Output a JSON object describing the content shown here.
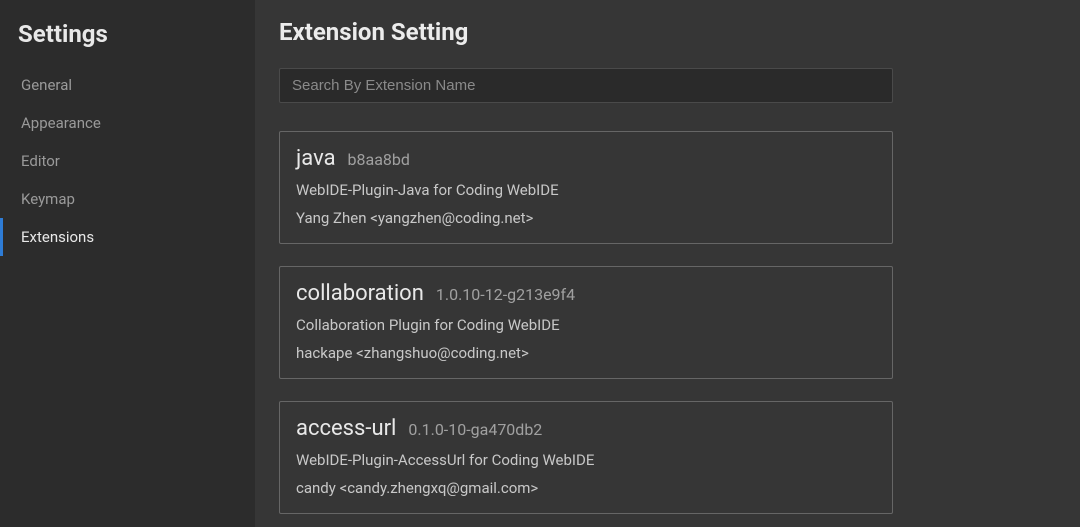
{
  "sidebar": {
    "title": "Settings",
    "items": [
      {
        "label": "General"
      },
      {
        "label": "Appearance"
      },
      {
        "label": "Editor"
      },
      {
        "label": "Keymap"
      },
      {
        "label": "Extensions"
      }
    ],
    "activeIndex": 4
  },
  "main": {
    "title": "Extension Setting",
    "search": {
      "placeholder": "Search By Extension Name",
      "value": ""
    },
    "extensions": [
      {
        "name": "java",
        "version": "b8aa8bd",
        "description": "WebIDE-Plugin-Java for Coding WebIDE",
        "author": "Yang Zhen <yangzhen@coding.net>"
      },
      {
        "name": "collaboration",
        "version": "1.0.10-12-g213e9f4",
        "description": "Collaboration Plugin for Coding WebIDE",
        "author": "hackape <zhangshuo@coding.net>"
      },
      {
        "name": "access-url",
        "version": "0.1.0-10-ga470db2",
        "description": "WebIDE-Plugin-AccessUrl for Coding WebIDE",
        "author": "candy <candy.zhengxq@gmail.com>"
      }
    ]
  }
}
